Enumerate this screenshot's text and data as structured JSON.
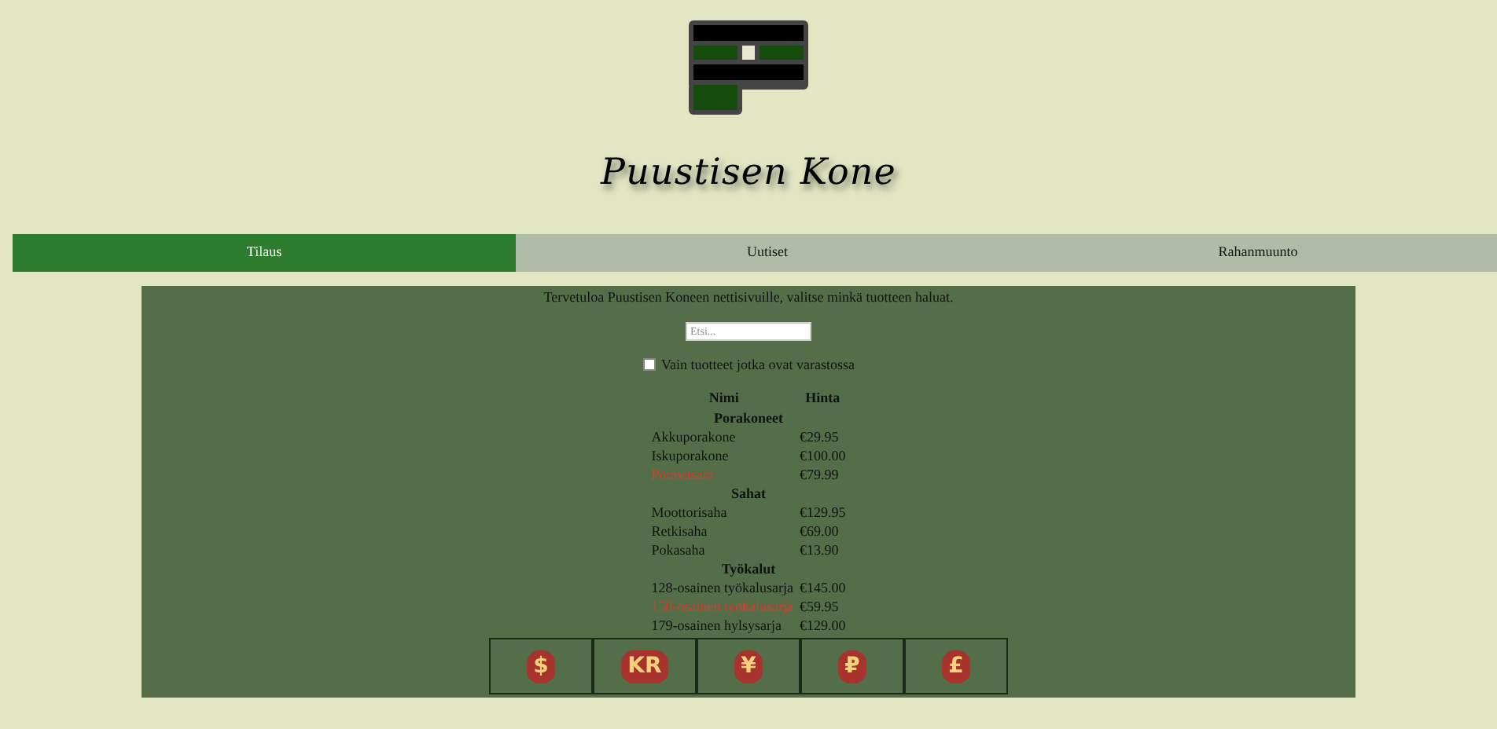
{
  "header": {
    "title": "Puustisen Kone"
  },
  "tabs": [
    {
      "label": "Tilaus",
      "selected": true
    },
    {
      "label": "Uutiset",
      "selected": false
    },
    {
      "label": "Rahanmuunto",
      "selected": false
    }
  ],
  "welcome": "Tervetuloa Puustisen Koneen nettisivuille, valitse minkä tuotteen haluat.",
  "search": {
    "placeholder": "Etsi..."
  },
  "stock_filter": {
    "label": "Vain tuotteet jotka ovat varastossa",
    "checked": false
  },
  "table": {
    "columns": [
      "Nimi",
      "Hinta"
    ],
    "groups": [
      {
        "name": "Porakoneet",
        "rows": [
          {
            "name": "Akkuporakone",
            "price": "€29.95",
            "in_stock": true
          },
          {
            "name": "Iskuporakone",
            "price": "€100.00",
            "in_stock": true
          },
          {
            "name": "Poravasara",
            "price": "€79.99",
            "in_stock": false
          }
        ]
      },
      {
        "name": "Sahat",
        "rows": [
          {
            "name": "Moottorisaha",
            "price": "€129.95",
            "in_stock": true
          },
          {
            "name": "Retkisaha",
            "price": "€69.00",
            "in_stock": true
          },
          {
            "name": "Pokasaha",
            "price": "€13.90",
            "in_stock": true
          }
        ]
      },
      {
        "name": "Työkalut",
        "rows": [
          {
            "name": "128-osainen työkalusarja",
            "price": "€145.00",
            "in_stock": true
          },
          {
            "name": "150-osainen työkalusarja",
            "price": "€59.95",
            "in_stock": false
          },
          {
            "name": "179-osainen hylsysarja",
            "price": "€129.00",
            "in_stock": true
          }
        ]
      }
    ]
  },
  "currencies": [
    "$",
    "KR",
    "¥",
    "₽",
    "£"
  ]
}
